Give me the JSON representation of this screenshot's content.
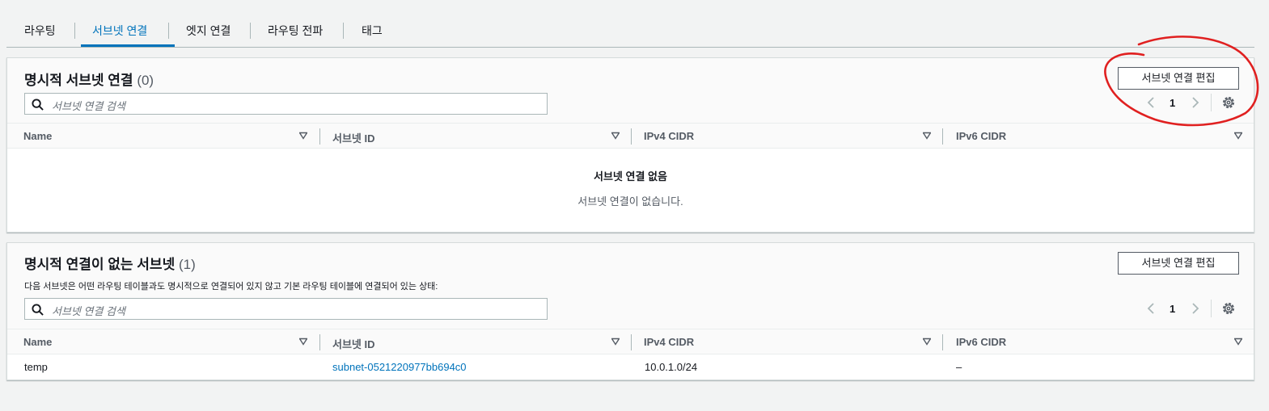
{
  "tabs": [
    {
      "label": "라우팅"
    },
    {
      "label": "서브넷 연결"
    },
    {
      "label": "엣지 연결"
    },
    {
      "label": "라우팅 전파"
    },
    {
      "label": "태그"
    }
  ],
  "explicit": {
    "title": "명시적 서브넷 연결",
    "count": "(0)",
    "edit_button": "서브넷 연결 편집",
    "search_placeholder": "서브넷 연결 검색",
    "page": "1",
    "columns": [
      "Name",
      "서브넷 ID",
      "IPv4 CIDR",
      "IPv6 CIDR"
    ],
    "empty_title": "서브넷 연결 없음",
    "empty_desc": "서브넷 연결이 없습니다."
  },
  "implicit": {
    "title": "명시적 연결이 없는 서브넷",
    "count": "(1)",
    "description": "다음 서브넷은 어떤 라우팅 테이블과도 명시적으로 연결되어 있지 않고 기본 라우팅 테이블에 연결되어 있는 상태:",
    "edit_button": "서브넷 연결 편집",
    "search_placeholder": "서브넷 연결 검색",
    "page": "1",
    "columns": [
      "Name",
      "서브넷 ID",
      "IPv4 CIDR",
      "IPv6 CIDR"
    ],
    "rows": [
      {
        "name": "temp",
        "subnet_id": "subnet-0521220977bb694c0",
        "ipv4": "10.0.1.0/24",
        "ipv6": "–"
      }
    ]
  },
  "colors": {
    "accent": "#0073bb",
    "annotation": "#e02020",
    "background": "#f2f3f3"
  },
  "icons": [
    "search-icon",
    "chevron-left-icon",
    "chevron-right-icon",
    "gear-icon",
    "sort-caret-icon"
  ]
}
